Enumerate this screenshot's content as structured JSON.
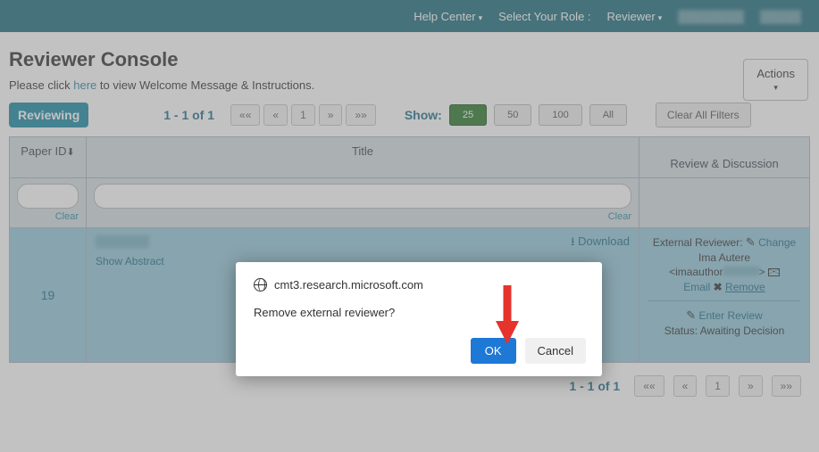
{
  "topbar": {
    "help": "Help Center",
    "selectRole": "Select Your Role :",
    "reviewer": "Reviewer"
  },
  "page": {
    "title": "Reviewer Console",
    "instr_pre": "Please click ",
    "instr_link": "here",
    "instr_post": " to view Welcome Message & Instructions."
  },
  "toolbar": {
    "pill": "Reviewing",
    "pager_info": "1 - 1 of 1",
    "show_label": "Show:",
    "show_opts": {
      "a": "25",
      "b": "50",
      "c": "100",
      "d": "All"
    },
    "clear_filters": "Clear All Filters",
    "pg": {
      "first": "««",
      "prev": "«",
      "page": "1",
      "next": "»",
      "last": "»»"
    },
    "actions": "Actions"
  },
  "table": {
    "head": {
      "id": "Paper ID",
      "title": "Title",
      "rd": "Review & Discussion"
    },
    "clear": "Clear",
    "row": {
      "id": "19",
      "show_abstract": "Show Abstract",
      "download": "Download",
      "ext_label": "External Reviewer: ",
      "change": "Change",
      "name": "Ima Autere",
      "email_pre": "<imaauthor",
      "email_post": ">",
      "email_link": "Email",
      "remove": "Remove",
      "enter_review": "Enter Review",
      "status": "Status: Awaiting Decision"
    }
  },
  "footer": {
    "info": "1 - 1 of 1"
  },
  "modal": {
    "host": "cmt3.research.microsoft.com",
    "message": "Remove external reviewer?",
    "ok": "OK",
    "cancel": "Cancel"
  }
}
